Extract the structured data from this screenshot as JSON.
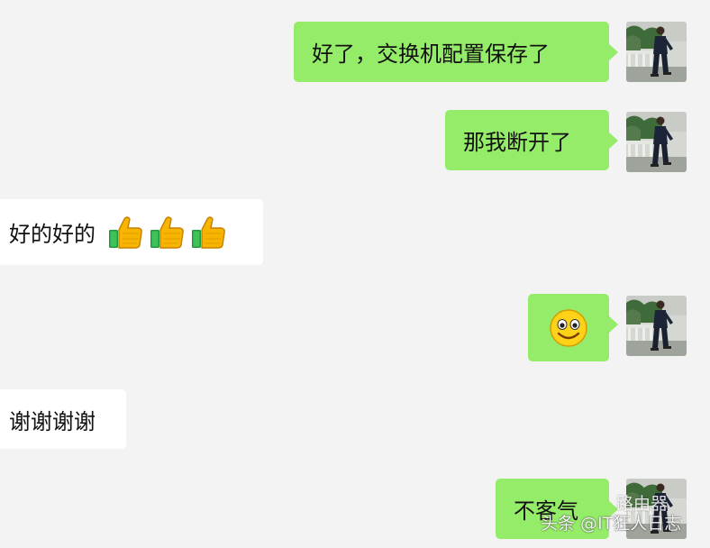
{
  "messages": [
    {
      "direction": "out",
      "text": "好了，交换机配置保存了"
    },
    {
      "direction": "out",
      "text": "那我断开了"
    },
    {
      "direction": "in",
      "text": "好的好的",
      "emoji": [
        "thumbs-up-icon",
        "thumbs-up-icon",
        "thumbs-up-icon"
      ]
    },
    {
      "direction": "out",
      "emoji": [
        "smile-icon"
      ]
    },
    {
      "direction": "in",
      "text": "谢谢谢谢"
    },
    {
      "direction": "out",
      "text": "不客气"
    }
  ],
  "watermark": {
    "text": "头条 @IT狂人日志",
    "partial_text": "路由器"
  },
  "colors": {
    "background": "#f3f3f3",
    "outgoing_bubble": "#95ec69",
    "incoming_bubble": "#ffffff"
  }
}
